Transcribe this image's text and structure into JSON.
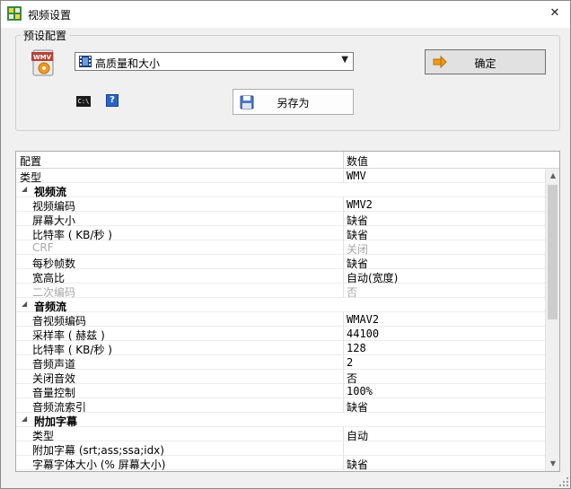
{
  "window": {
    "title": "视频设置",
    "close_glyph": "✕"
  },
  "preset": {
    "group_label": "预设配置",
    "selected": "高质量和大小",
    "ok_label": "确定",
    "save_as_label": "另存为",
    "cmd_glyph": "C:\\",
    "help_glyph": "?",
    "badge_text": "WMV"
  },
  "grid": {
    "col_config": "配置",
    "col_value": "数值",
    "rows": [
      {
        "type": "top",
        "key": "类型",
        "value": "WMV",
        "mono": true
      },
      {
        "type": "cat",
        "key": "视频流",
        "toggle": "◢"
      },
      {
        "type": "item",
        "key": "视频编码",
        "value": "WMV2",
        "mono": true
      },
      {
        "type": "item",
        "key": "屏幕大小",
        "value": "缺省"
      },
      {
        "type": "item",
        "key": "比特率 ( KB/秒 )",
        "value": "缺省"
      },
      {
        "type": "item",
        "key": "CRF",
        "value": "关闭",
        "disabled": true
      },
      {
        "type": "item",
        "key": "每秒帧数",
        "value": "缺省"
      },
      {
        "type": "item",
        "key": "宽高比",
        "value": "自动(宽度)"
      },
      {
        "type": "item",
        "key": "二次编码",
        "value": "否",
        "disabled": true
      },
      {
        "type": "cat",
        "key": "音频流",
        "toggle": "◢"
      },
      {
        "type": "item",
        "key": "音视频编码",
        "value": "WMAV2",
        "mono": true
      },
      {
        "type": "item",
        "key": "采样率 ( 赫兹 )",
        "value": "44100",
        "mono": true
      },
      {
        "type": "item",
        "key": "比特率 ( KB/秒 )",
        "value": "128",
        "mono": true
      },
      {
        "type": "item",
        "key": "音频声道",
        "value": "2",
        "mono": true
      },
      {
        "type": "item",
        "key": "关闭音效",
        "value": "否"
      },
      {
        "type": "item",
        "key": "音量控制",
        "value": "100%",
        "mono": true
      },
      {
        "type": "item",
        "key": "音频流索引",
        "value": "缺省"
      },
      {
        "type": "cat",
        "key": "附加字幕",
        "toggle": "◢"
      },
      {
        "type": "item",
        "key": "类型",
        "value": "自动"
      },
      {
        "type": "item",
        "key": "附加字幕 (srt;ass;ssa;idx)",
        "value": ""
      },
      {
        "type": "item",
        "key": "字幕字体大小 (% 屏幕大小)",
        "value": "缺省"
      }
    ]
  },
  "scrollbar": {
    "up_glyph": "▲",
    "down_glyph": "▼"
  },
  "colors": {
    "accent_orange": "#f29a1e",
    "help_blue": "#2a63c9"
  }
}
